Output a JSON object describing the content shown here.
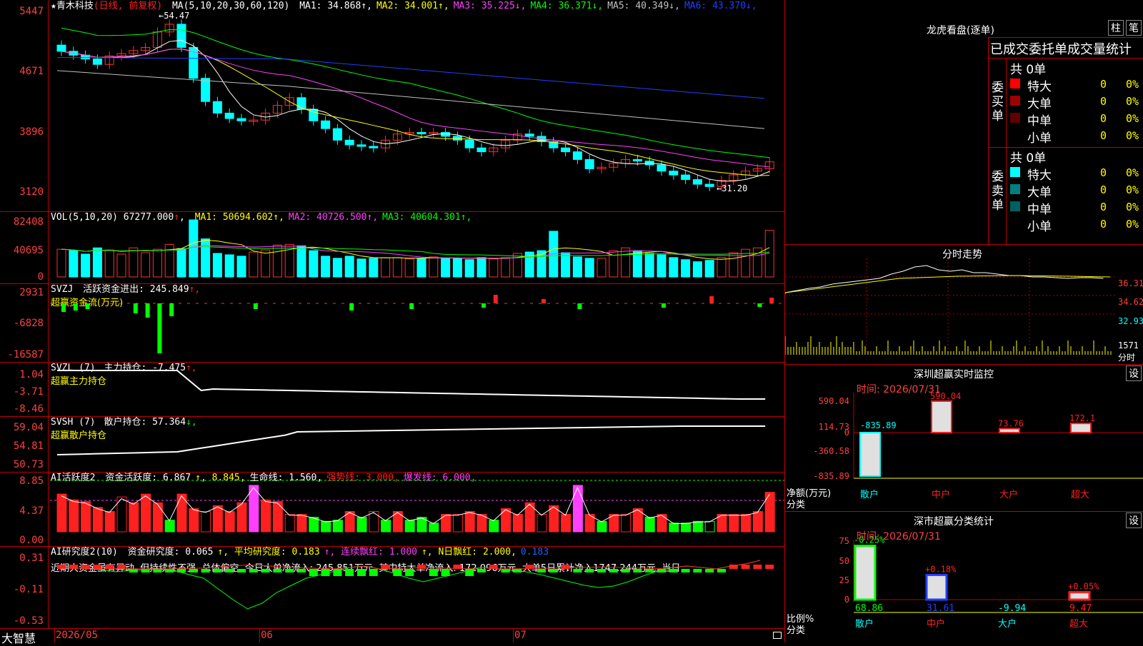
{
  "stock": {
    "name": "青木科技",
    "mode": "(日线, 前复权)"
  },
  "kline": {
    "ma_header": "MA(5,10,20,30,60,120)",
    "ma": [
      {
        "label": "MA1:",
        "value": "34.868",
        "arrow": "↑",
        "color": "#ffffff"
      },
      {
        "label": "MA2:",
        "value": "34.001",
        "arrow": "↑",
        "color": "#ffff00"
      },
      {
        "label": "MA3:",
        "value": "35.225",
        "arrow": "↓",
        "color": "#ff40ff"
      },
      {
        "label": "MA4:",
        "value": "36.371",
        "arrow": "↓",
        "color": "#00ff00"
      },
      {
        "label": "MA5:",
        "value": "40.349",
        "arrow": "↓",
        "color": "#c0c0c0"
      },
      {
        "label": "MA6:",
        "value": "43.370",
        "arrow": "↓",
        "color": "#2040ff"
      }
    ],
    "yticks": [
      "5447",
      "4671",
      "3896",
      "3120"
    ],
    "high_marker": "54.47",
    "low_marker": "31.20",
    "ylim": [
      3120,
      5447
    ]
  },
  "vol": {
    "header": "VOL(5,10,20)",
    "value": "67277.000",
    "ma": [
      {
        "label": "MA1:",
        "value": "50694.602",
        "arrow": "↑",
        "color": "#ffff00"
      },
      {
        "label": "MA2:",
        "value": "40726.500",
        "arrow": "↑",
        "color": "#ff40ff"
      },
      {
        "label": "MA3:",
        "value": "40604.301",
        "arrow": "↑",
        "color": "#00ff00"
      }
    ],
    "yticks": [
      "82408",
      "40695",
      "0"
    ]
  },
  "svzj": {
    "header": "SVZJ",
    "label": "活跃资金进出:",
    "value": "245.849",
    "arrow": "↑,",
    "sub": "超赢资金流(万元)",
    "yticks": [
      "2931",
      "-6828",
      "-16587"
    ]
  },
  "svzl": {
    "header": "SVZL (7)",
    "label": "主力持仓:",
    "value": "-7.475",
    "arrow": "↑,",
    "sub": "超赢主力持仓",
    "yticks": [
      "1.04",
      "-3.71",
      "-8.46"
    ]
  },
  "svsh": {
    "header": "SVSH (7)",
    "label": "散户持仓:",
    "value": "57.364",
    "arrow": "↓,",
    "sub": "超赢散户持仓",
    "yticks": [
      "59.04",
      "54.81",
      "50.73"
    ]
  },
  "ai1": {
    "header": "AI活跃度2",
    "items": [
      {
        "text": "资金活跃度: 6.867",
        "color": "#ffffff"
      },
      {
        "text": "↑, 8.845,",
        "color": "#ffff00"
      },
      {
        "text": "生命线: 1.560,",
        "color": "#ffffff"
      },
      {
        "text": "强势线: 3.000,",
        "color": "#ff2020"
      },
      {
        "text": "爆发线: 6.000,",
        "color": "#ff40ff"
      }
    ],
    "yticks": [
      "8.85",
      "4.37",
      "0.00"
    ]
  },
  "ai2": {
    "header": "AI研究度2(10)",
    "items": [
      {
        "text": "资金研究度: 0.065",
        "color": "#ffffff"
      },
      {
        "text": "↑, 平均研究度: 0.183",
        "color": "#ffff00"
      },
      {
        "text": "↑, 连续飘红: 1.000",
        "color": "#ff40ff"
      },
      {
        "text": "↑, N日飘红: 2.000,",
        "color": "#ffff00"
      },
      {
        "text": "0.183",
        "color": "#2060ff"
      }
    ],
    "comment": "近期大资金虽有异动, 但持续性不强, 总体偏空, 今日大单净流入: 245.851万元, 其中特大单净流入: 172.096万元, 大单5日累计净入1747.244万元, 当日",
    "yticks": [
      "0.31",
      "-0.11",
      "-0.53"
    ]
  },
  "xaxis": {
    "brand": "大智慧",
    "labels": [
      "2026/05",
      "06",
      "07"
    ]
  },
  "right": {
    "lhb_title": "龙虎看盘(逐单)",
    "btn_zhu": "柱",
    "btn_bi": "笔",
    "stat_title": "已成交委托单成交量统计",
    "buy": {
      "side": "委买单",
      "total": "共 0单",
      "rows": [
        {
          "name": "特大",
          "count": "0",
          "pct": "0%",
          "color": "#ff0000"
        },
        {
          "name": "大单",
          "count": "0",
          "pct": "0%",
          "color": "#a00000"
        },
        {
          "name": "中单",
          "count": "0",
          "pct": "0%",
          "color": "#600000"
        },
        {
          "name": "小单",
          "count": "0",
          "pct": "0%",
          "color": ""
        }
      ]
    },
    "sell": {
      "side": "委卖单",
      "total": "共 0单",
      "rows": [
        {
          "name": "特大",
          "count": "0",
          "pct": "0%",
          "color": "#00ffff"
        },
        {
          "name": "大单",
          "count": "0",
          "pct": "0%",
          "color": "#008080"
        },
        {
          "name": "中单",
          "count": "0",
          "pct": "0%",
          "color": "#006060"
        },
        {
          "name": "小单",
          "count": "0",
          "pct": "0%",
          "color": ""
        }
      ]
    },
    "fs_title": "分时走势",
    "fs_yticks": [
      "36.31",
      "34.62",
      "32.93",
      "1571",
      "分时"
    ],
    "sz_title": "深圳超赢实时监控",
    "sz_btn": "设",
    "sz_time": "时间: 2026/07/31",
    "sz_yticks": [
      "590.04",
      "114.73",
      "0",
      "-360.58",
      "-835.89"
    ],
    "sz_ylabel": "净额(万元)",
    "sz_xlabel": "分类",
    "sz_bars": [
      {
        "cat": "散户",
        "value": -835.89,
        "label": "-835.89",
        "color": "#00ffff"
      },
      {
        "cat": "中户",
        "value": 590.04,
        "label": "590.04",
        "color": "#ff2020"
      },
      {
        "cat": "大户",
        "value": 73.76,
        "label": "73.76",
        "color": "#ff2020"
      },
      {
        "cat": "超大",
        "value": 172.1,
        "label": "172.1",
        "color": "#ff2020"
      }
    ],
    "ss_title": "深市超赢分类统计",
    "ss_btn": "设",
    "ss_time": "时间: 2026/07/31",
    "ss_yticks": [
      "75",
      "50",
      "25",
      "0"
    ],
    "ss_ylabel": "比例%",
    "ss_xlabel": "分类",
    "ss_bars": [
      {
        "cat": "散户",
        "value": 68.86,
        "label": "68.86",
        "top": "-0.25%",
        "color": "#00ff00",
        "topcolor": "#00ff00"
      },
      {
        "cat": "中户",
        "value": 31.61,
        "label": "31.61",
        "top": "+0.18%",
        "color": "#2040ff",
        "topcolor": "#ff2020"
      },
      {
        "cat": "大户",
        "value": -9.94,
        "label": "-9.94",
        "top": "",
        "color": "#00ffff",
        "topcolor": "#00ffff"
      },
      {
        "cat": "超大",
        "value": 9.47,
        "label": "9.47",
        "top": "+0.05%",
        "color": "#ff2020",
        "topcolor": "#ff2020"
      }
    ]
  },
  "chart_data": [
    {
      "type": "candlestick",
      "title": "青木科技 (日线, 前复权)",
      "ylim": [
        31.2,
        54.47
      ],
      "close_approx": [
        49.5,
        49.0,
        48.5,
        47.8,
        48.9,
        49.2,
        49.6,
        50.0,
        52.0,
        53.0,
        50.0,
        46.0,
        43.0,
        41.5,
        40.8,
        40.5,
        40.6,
        41.5,
        42.5,
        43.5,
        42.0,
        40.5,
        39.5,
        38.0,
        37.4,
        37.2,
        37.0,
        38.0,
        38.8,
        39.0,
        38.9,
        39.0,
        38.5,
        38.0,
        37.0,
        36.5,
        37.0,
        38.0,
        38.8,
        38.5,
        37.8,
        37.0,
        36.5,
        35.5,
        34.3,
        34.5,
        35.0,
        35.5,
        35.3,
        34.8,
        34.0,
        33.5,
        32.9,
        32.3,
        32.0,
        32.8,
        33.5,
        34.0,
        34.3,
        35.2
      ]
    },
    {
      "type": "bar",
      "title": "VOL(5,10,20)",
      "ylim": [
        0,
        82408
      ],
      "values": [
        40000,
        38000,
        33000,
        42000,
        39000,
        33000,
        42000,
        35000,
        40000,
        47000,
        41000,
        82408,
        55000,
        34000,
        32000,
        30000,
        36000,
        39000,
        46000,
        47000,
        45000,
        38000,
        30000,
        27000,
        30000,
        26000,
        27000,
        28000,
        28000,
        26000,
        27000,
        29000,
        27000,
        27000,
        25000,
        28000,
        26000,
        28000,
        34000,
        36000,
        38000,
        66000,
        35000,
        29000,
        27000,
        27000,
        38000,
        42000,
        38000,
        34000,
        32000,
        28000,
        25000,
        22000,
        24000,
        28000,
        35000,
        40000,
        42000,
        67277
      ]
    }
  ]
}
